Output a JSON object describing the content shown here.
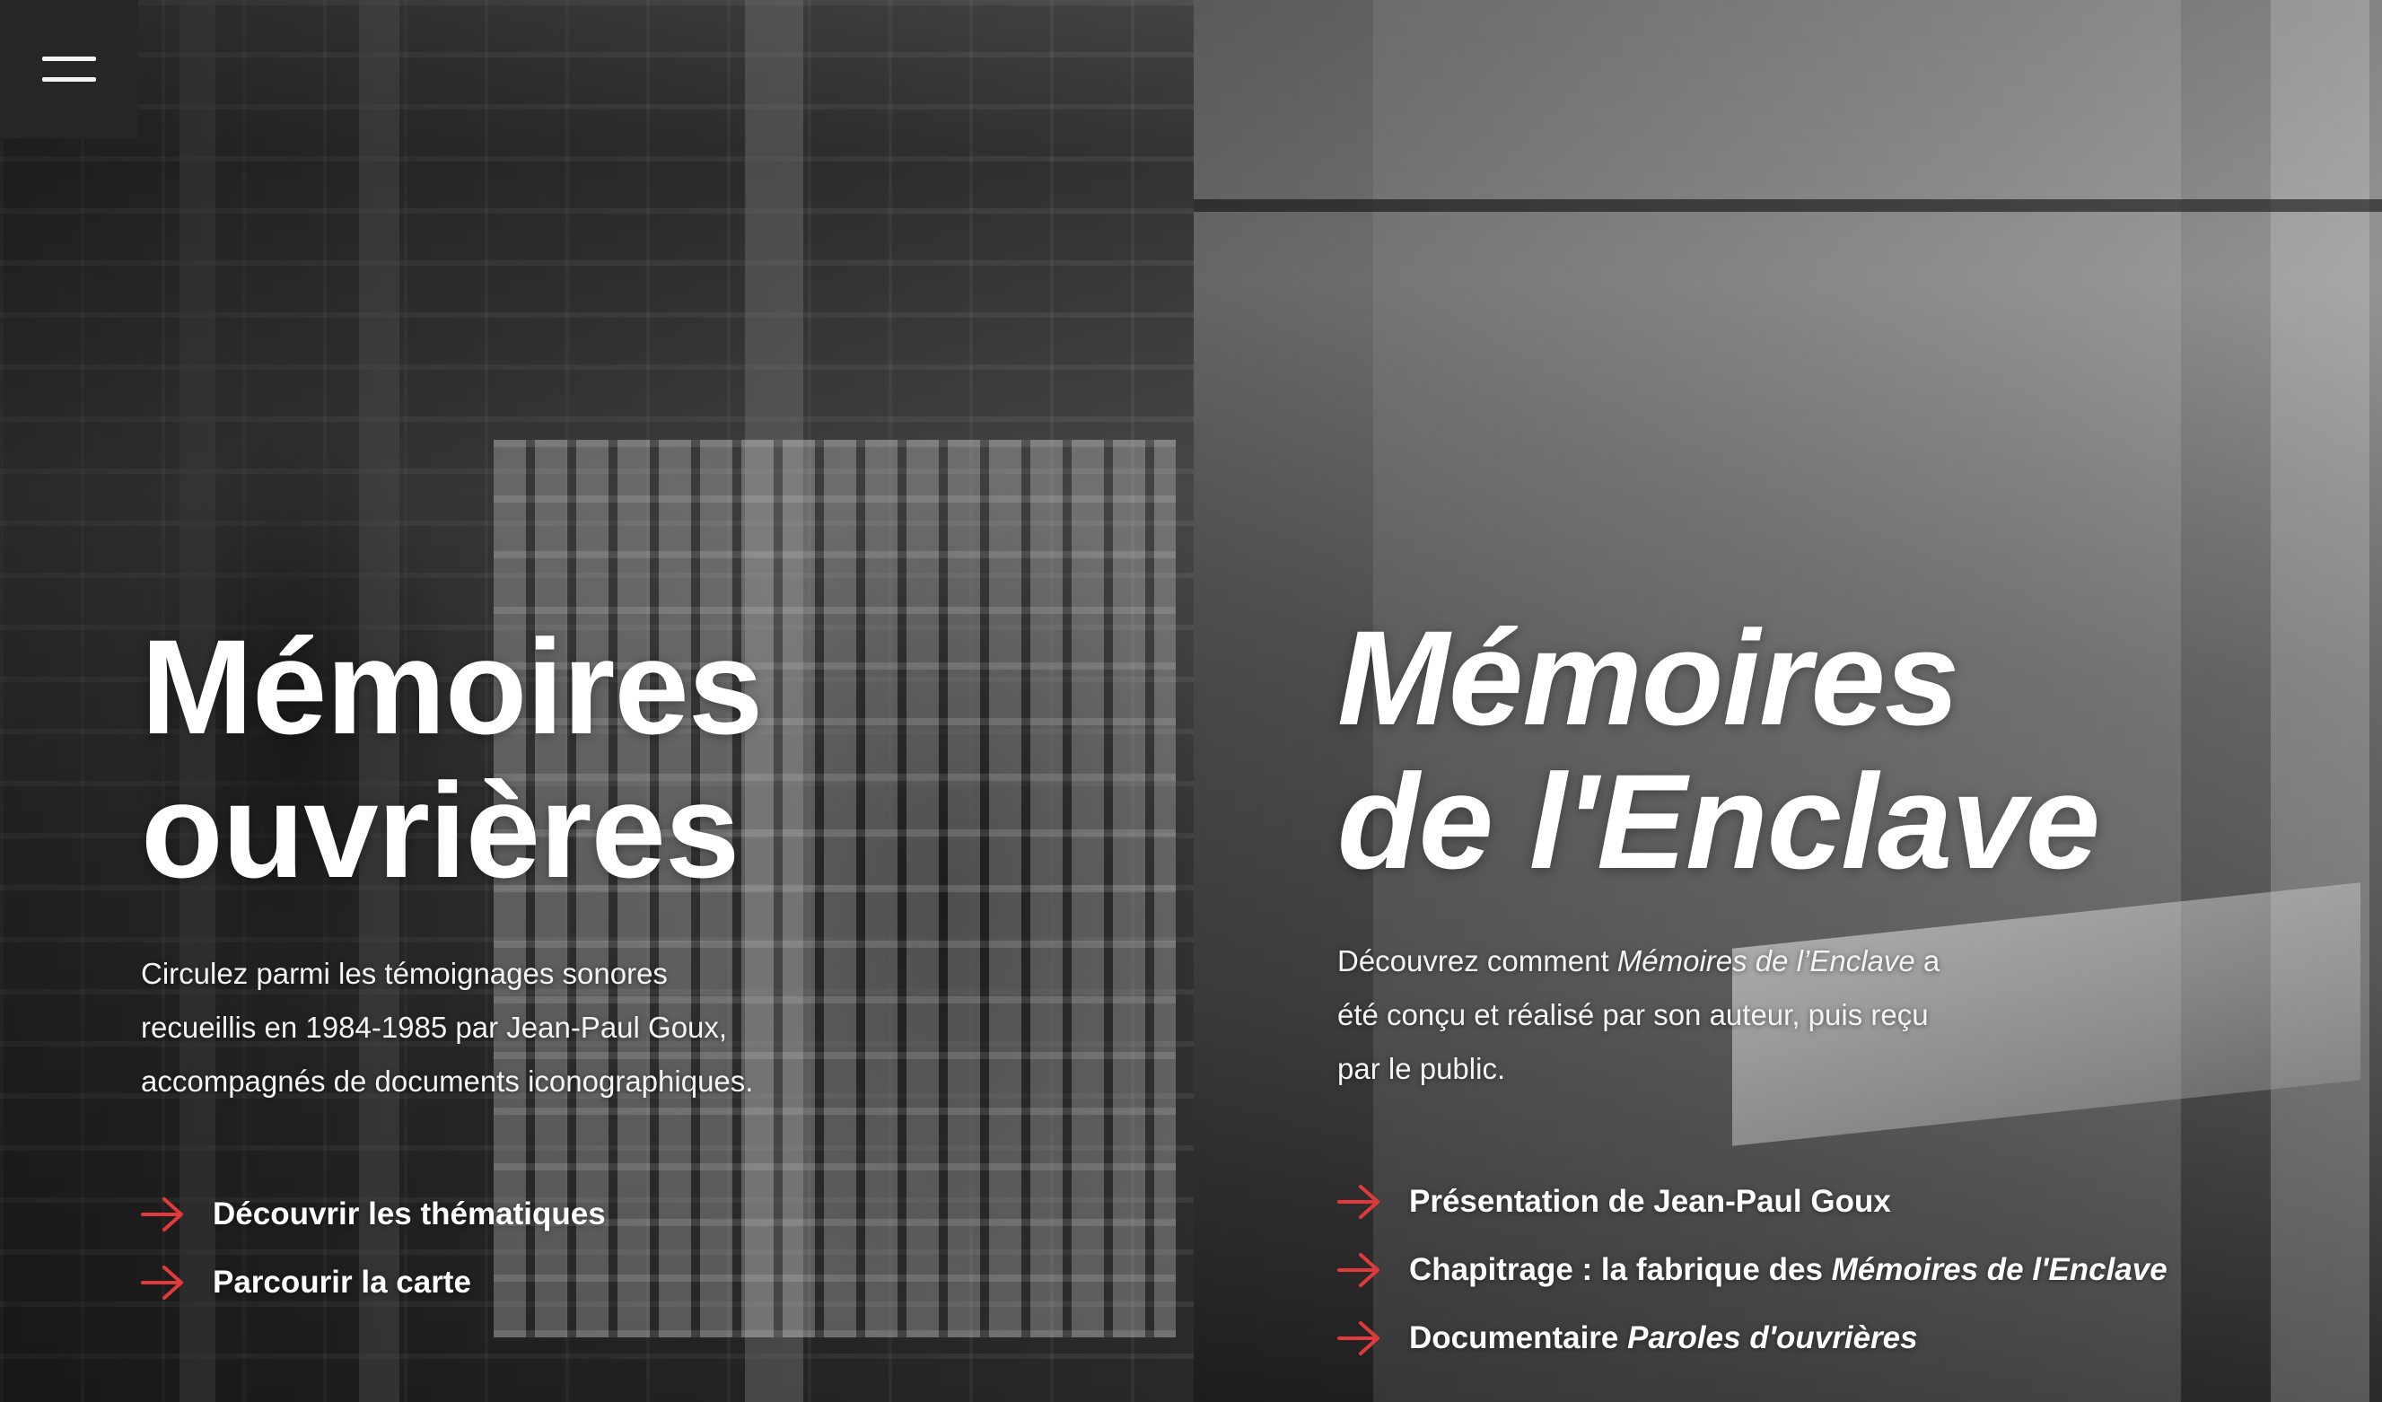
{
  "menu": {
    "icon": "hamburger-menu-icon"
  },
  "accent_color": "#e23a3a",
  "left_panel": {
    "title_line1": "Mémoires",
    "title_line2": "ouvrières",
    "description": "Circulez parmi les témoignages sonores recueillis en 1984-1985 par Jean-Paul Goux, accompagnés de documents iconographiques.",
    "links": [
      {
        "label": "Découvrir les thématiques",
        "icon": "arrow-right-icon"
      },
      {
        "label": "Parcourir la carte",
        "icon": "arrow-right-icon"
      }
    ]
  },
  "right_panel": {
    "title_line1": "Mémoires",
    "title_line2": "de l'Enclave",
    "description": {
      "before": "Découvrez comment ",
      "emphasis": "Mémoires de l’Enclave",
      "after": " a été conçu et réalisé par son auteur, puis reçu par le public."
    },
    "links": [
      {
        "label": "Présentation de Jean-Paul Goux",
        "emphasis": "",
        "icon": "arrow-right-icon"
      },
      {
        "label": "Chapitrage : la fabrique des ",
        "emphasis": "Mémoires de l'Enclave",
        "icon": "arrow-right-icon"
      },
      {
        "label": "Documentaire ",
        "emphasis": "Paroles d'ouvrières",
        "icon": "arrow-right-icon"
      }
    ]
  }
}
